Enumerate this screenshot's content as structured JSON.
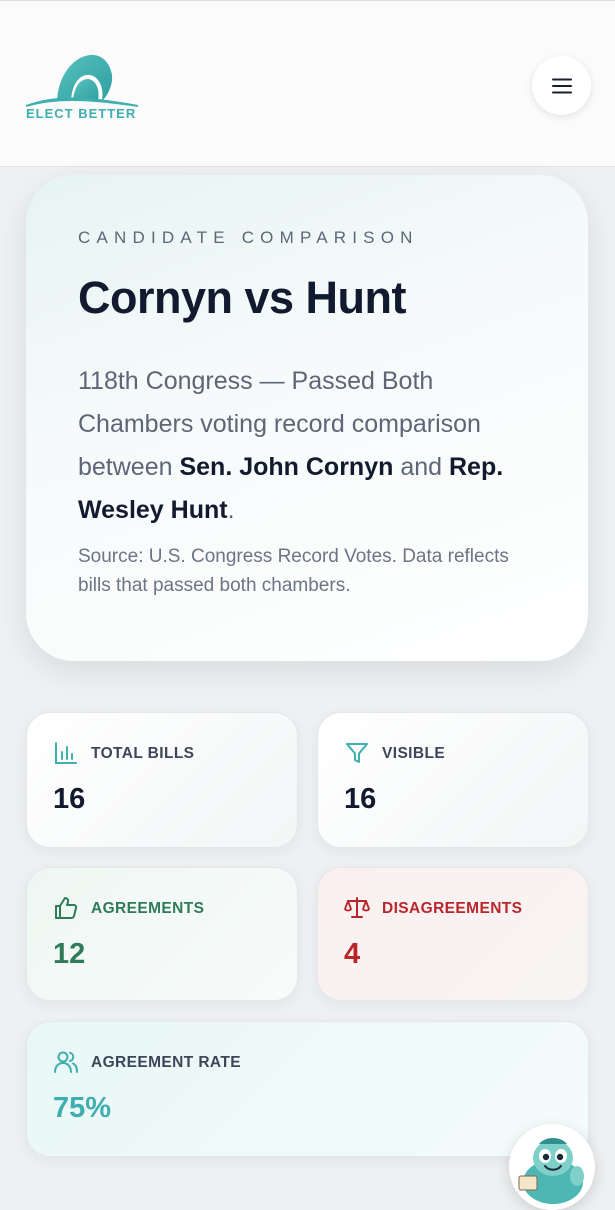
{
  "header": {
    "logo_text": "ELECT BETTER",
    "menu_icon": "hamburger-icon"
  },
  "hero": {
    "eyebrow": "CANDIDATE COMPARISON",
    "title": "Cornyn vs Hunt",
    "desc_prefix": "118th Congress — Passed Both Chambers voting record comparison between ",
    "candidate_a": "Sen. John Cornyn",
    "desc_and": " and ",
    "candidate_b": "Rep. Wesley Hunt",
    "desc_end": ".",
    "source": "Source: U.S. Congress Record Votes. Data reflects bills that passed both chambers."
  },
  "stats": {
    "total_bills": {
      "label": "TOTAL BILLS",
      "value": "16",
      "icon": "bar-chart-icon"
    },
    "visible": {
      "label": "VISIBLE",
      "value": "16",
      "icon": "filter-icon"
    },
    "agreements": {
      "label": "AGREEMENTS",
      "value": "12",
      "icon": "thumbs-up-icon"
    },
    "disagreements": {
      "label": "DISAGREEMENTS",
      "value": "4",
      "icon": "scale-icon"
    },
    "agreement_rate": {
      "label": "AGREEMENT RATE",
      "value": "75%",
      "icon": "users-icon"
    }
  },
  "colors": {
    "brand_teal": "#3eaeae",
    "navy": "#111a2e",
    "green": "#2f7a57",
    "red": "#b8262b"
  }
}
